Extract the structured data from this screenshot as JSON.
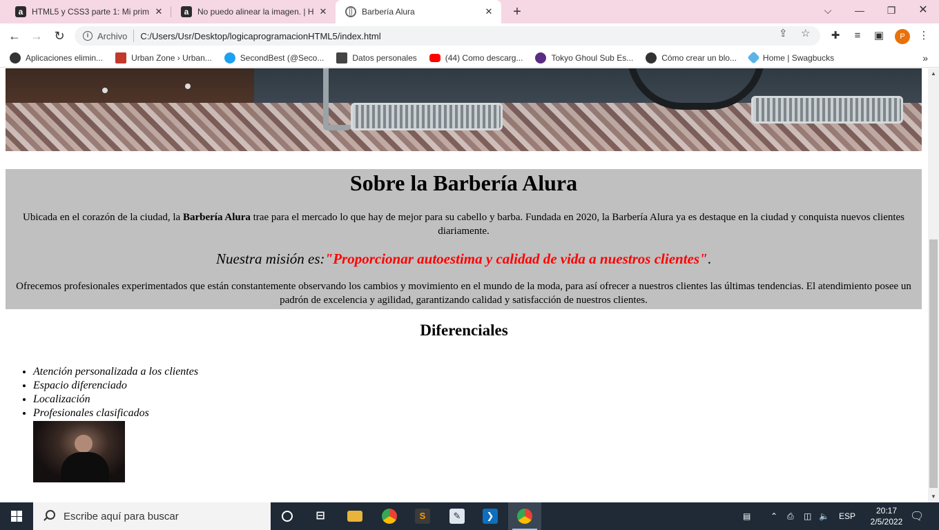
{
  "browser": {
    "tabs": [
      {
        "label": "HTML5 y CSS3 parte 1: Mi primer",
        "favicon": "a"
      },
      {
        "label": "No puedo alinear la imagen. | HT",
        "favicon": "a"
      },
      {
        "label": "Barbería Alura",
        "favicon": "globe"
      }
    ],
    "address": {
      "scheme": "Archivo",
      "url": "C:/Users/Usr/Desktop/logicaprogramacionHTML5/index.html"
    },
    "bookmarks": [
      {
        "label": "Aplicaciones elimin...",
        "icon": "globe-icon",
        "color": "#333333"
      },
      {
        "label": "Urban Zone › Urban...",
        "icon": "urban-icon",
        "color": "#c0392b"
      },
      {
        "label": "SecondBest (@Seco...",
        "icon": "twitter-icon",
        "color": "#1da1f2"
      },
      {
        "label": "Datos personales",
        "icon": "epic-icon",
        "color": "#444444"
      },
      {
        "label": "(44) Como descarg...",
        "icon": "youtube-icon",
        "color": "#ff0000"
      },
      {
        "label": "Tokyo Ghoul Sub Es...",
        "icon": "ghoul-icon",
        "color": "#5b2c83"
      },
      {
        "label": "Cómo crear un blo...",
        "icon": "globe-icon",
        "color": "#333333"
      },
      {
        "label": "Home | Swagbucks",
        "icon": "swagbucks-icon",
        "color": "#5ab4e8"
      }
    ],
    "avatar_letter": "P"
  },
  "page": {
    "about": {
      "heading": "Sobre la Barbería Alura",
      "p1_before": "Ubicada en el corazón de la ciudad, la ",
      "p1_bold": "Barbería Alura",
      "p1_after": " trae para el mercado lo que hay de mejor para su cabello y barba. Fundada en 2020, la Barbería Alura ya es destaque en la ciudad y conquista nuevos clientes diariamente.",
      "mission_label": "Nuestra misión es:",
      "mission_quote": "\"Proporcionar autoestima y calidad de vida a nuestros clientes\"",
      "mission_end": ".",
      "p2": "Ofrecemos profesionales experimentados que están constantemente observando los cambios y movimiento en el mundo de la moda, para así ofrecer a nuestros clientes las últimas tendencias. El atendimiento posee un padrón de excelencia y agilidad, garantizando calidad y satisfacción de nuestros clientes."
    },
    "differentials": {
      "heading": "Diferenciales",
      "items": [
        "Atención personalizada a los clientes",
        "Espacio diferenciado",
        "Localización",
        "Profesionales clasificados"
      ]
    }
  },
  "taskbar": {
    "search_placeholder": "Escribe aquí para buscar",
    "language": "ESP",
    "time": "20:17",
    "date": "2/5/2022"
  },
  "colors": {
    "accent_red": "#ff0000",
    "about_bg": "#c0c0c0",
    "tabstrip": "#f6d7e4"
  }
}
